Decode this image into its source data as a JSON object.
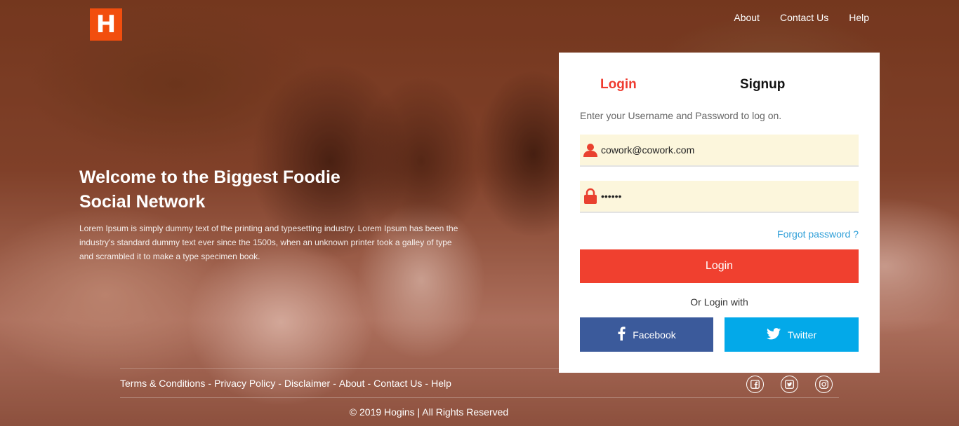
{
  "brand": {
    "logo_letter": "H",
    "color": "#f24e0e"
  },
  "nav": {
    "items": [
      "About",
      "Contact Us",
      "Help"
    ]
  },
  "hero": {
    "title": "Welcome to the Biggest Foodie Social Network",
    "text": "Lorem Ipsum is simply dummy text of the printing and typesetting industry. Lorem Ipsum has been the industry's standard dummy text ever since the 1500s, when an unknown printer took a galley of type and scrambled it to make a type specimen book."
  },
  "card": {
    "tab_login": "Login",
    "tab_signup": "Signup",
    "description": "Enter your Username and Password to log on.",
    "username_value": "cowork@cowork.com",
    "password_value": "••••••",
    "username_icon": "user-icon",
    "password_icon": "lock-icon",
    "forgot_label": "Forgot password ?",
    "login_button": "Login",
    "or_label": "Or Login with",
    "facebook_label": "Facebook",
    "twitter_label": "Twitter",
    "colors": {
      "accent": "#f0402f",
      "facebook": "#3b5a9b",
      "twitter": "#03a9e9",
      "link": "#2f9fd8",
      "field_bg": "#fcf6dc"
    }
  },
  "footer": {
    "links": [
      "Terms & Conditions",
      "Privacy Policy",
      "Disclaimer",
      "About",
      "Contact Us",
      "Help"
    ],
    "separator": "-",
    "social_icons": [
      "facebook-icon",
      "twitter-icon",
      "instagram-icon"
    ],
    "copyright": "© 2019 Hogins | All Rights Reserved"
  }
}
